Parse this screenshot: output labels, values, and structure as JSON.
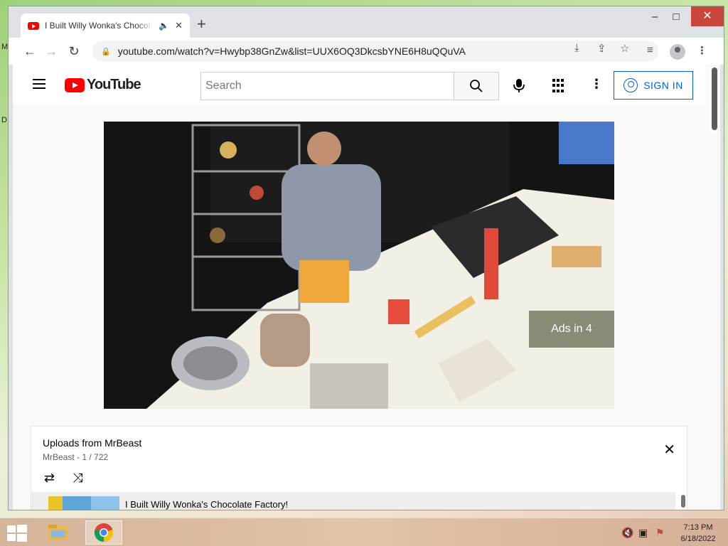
{
  "desktop": {
    "edge_text_top": "M",
    "edge_text_mid": "D"
  },
  "browser": {
    "tab_title": "I Built Willy Wonka's Chocolate Factory!",
    "audio_icon": "speaker-icon",
    "url": "youtube.com/watch?v=Hwybp38GnZw&list=UUX6OQ3DkcsbYNE6H8uQQuVA",
    "window_controls": {
      "minimize": "–",
      "maximize": "□",
      "close": "✕"
    }
  },
  "youtube": {
    "logo_text": "YouTube",
    "search_placeholder": "Search",
    "sign_in_label": "SIGN IN",
    "ads_label": "Ads in 4"
  },
  "playlist": {
    "title": "Uploads from MrBeast",
    "subtitle": "MrBeast - 1 / 722",
    "current_video": "I Built Willy Wonka's Chocolate Factory!"
  },
  "taskbar": {
    "time": "7:13 PM",
    "date": "6/18/2022",
    "accent": "#c8463b"
  }
}
